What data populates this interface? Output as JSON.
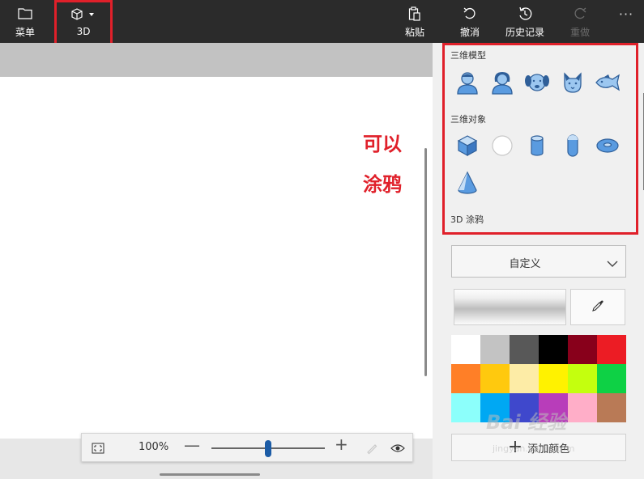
{
  "toolbar": {
    "menu_label": "菜单",
    "threed_label": "3D",
    "paste_label": "粘贴",
    "undo_label": "撤消",
    "history_label": "历史记录",
    "redo_label": "重做",
    "more_label": "···"
  },
  "annotation": {
    "line1": "可以",
    "line2": "涂鸦"
  },
  "panel": {
    "models_title": "三维模型",
    "models": [
      "man-model-icon",
      "woman-model-icon",
      "dog-model-icon",
      "cat-model-icon",
      "fish-model-icon"
    ],
    "objects_title": "三维对象",
    "objects": [
      "cube-icon",
      "sphere-icon",
      "cylinder-icon",
      "capsule-icon",
      "torus-icon",
      "cone-icon"
    ],
    "doodle_title": "3D 涂鸦",
    "select_value": "自定义",
    "add_color_label": "添加颜色",
    "palette": [
      "#ffffff",
      "#c3c3c3",
      "#585858",
      "#000000",
      "#88001b",
      "#ec1c24",
      "#ff7f27",
      "#ffc90e",
      "#fdeca6",
      "#fff200",
      "#c4ff0e",
      "#0ed145",
      "#8cfffb",
      "#00a8f3",
      "#3f48cc",
      "#b83dba",
      "#ffaec8",
      "#b97a56"
    ]
  },
  "zoom": {
    "value": "100%",
    "minus": "—",
    "plus": "+",
    "level": 0.5
  },
  "watermark": {
    "main": "Bai 经验",
    "sub": "jingyan.baidu.com"
  },
  "colors": {
    "toolbar_bg": "#2b2b2b",
    "highlight_red": "#e0202a",
    "icon_blue": "#4a90d9",
    "slider_blue": "#1c5ca6"
  }
}
